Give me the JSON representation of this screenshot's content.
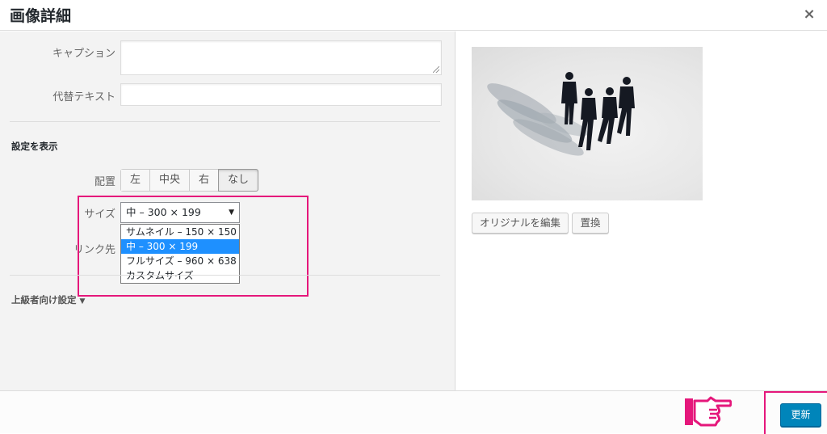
{
  "dialog": {
    "title": "画像詳細",
    "close_symbol": "×"
  },
  "fields": {
    "caption_label": "キャプション",
    "caption_value": "",
    "alt_label": "代替テキスト",
    "alt_value": ""
  },
  "display_settings": {
    "heading": "設定を表示",
    "align_label": "配置",
    "align_options": [
      "左",
      "中央",
      "右",
      "なし"
    ],
    "align_selected": "なし",
    "size_label": "サイズ",
    "size_selected": "中 – 300 × 199",
    "size_options": [
      "サムネイル – 150 × 150",
      "中 – 300 × 199",
      "フルサイズ – 960 × 638",
      "カスタムサイズ"
    ],
    "link_label": "リンク先"
  },
  "advanced": {
    "label": "上級者向け設定",
    "toggle_icon": "triangle-down-icon"
  },
  "preview": {
    "edit_original": "オリジナルを編集",
    "replace": "置換"
  },
  "footer": {
    "update_button": "更新",
    "pointer_icon": "pointing-hand-icon"
  },
  "colors": {
    "highlight": "#e5177b",
    "primary": "#0085ba",
    "selected_option": "#1e90ff"
  }
}
